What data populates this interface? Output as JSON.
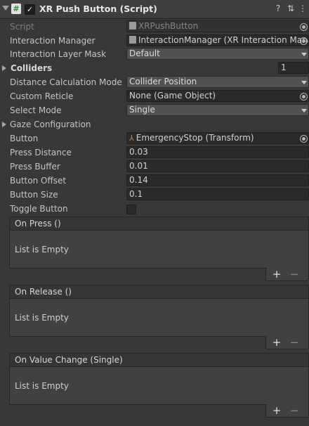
{
  "header": {
    "title": "XR Push Button (Script)",
    "script_glyph": "#",
    "enabled_glyph": "✓",
    "help_glyph": "?",
    "settings_glyph": "⇅",
    "menu_glyph": "⋮"
  },
  "fields": {
    "script": {
      "label": "Script",
      "value": "XRPushButton"
    },
    "interaction_manager": {
      "label": "Interaction Manager",
      "value": "InteractionManager (XR Interaction Mana"
    },
    "interaction_layer_mask": {
      "label": "Interaction Layer Mask",
      "value": "Default"
    },
    "colliders": {
      "label": "Colliders",
      "value": "1"
    },
    "distance_calculation_mode": {
      "label": "Distance Calculation Mode",
      "value": "Collider Position"
    },
    "custom_reticle": {
      "label": "Custom Reticle",
      "value": "None (Game Object)"
    },
    "select_mode": {
      "label": "Select Mode",
      "value": "Single"
    },
    "gaze_configuration": {
      "label": "Gaze Configuration"
    },
    "button": {
      "label": "Button",
      "value": "EmergencyStop (Transform)",
      "icon_glyph": "⅄"
    },
    "press_distance": {
      "label": "Press Distance",
      "value": "0.03"
    },
    "press_buffer": {
      "label": "Press Buffer",
      "value": "0.01"
    },
    "button_offset": {
      "label": "Button Offset",
      "value": "0.14"
    },
    "button_size": {
      "label": "Button Size",
      "value": "0.1"
    },
    "toggle_button": {
      "label": "Toggle Button",
      "checked": false
    }
  },
  "events": [
    {
      "title": "On Press ()",
      "empty_text": "List is Empty",
      "plus": "+",
      "minus": "−"
    },
    {
      "title": "On Release ()",
      "empty_text": "List is Empty",
      "plus": "+",
      "minus": "−"
    },
    {
      "title": "On Value Change (Single)",
      "empty_text": "List is Empty",
      "plus": "+",
      "minus": "−"
    }
  ]
}
